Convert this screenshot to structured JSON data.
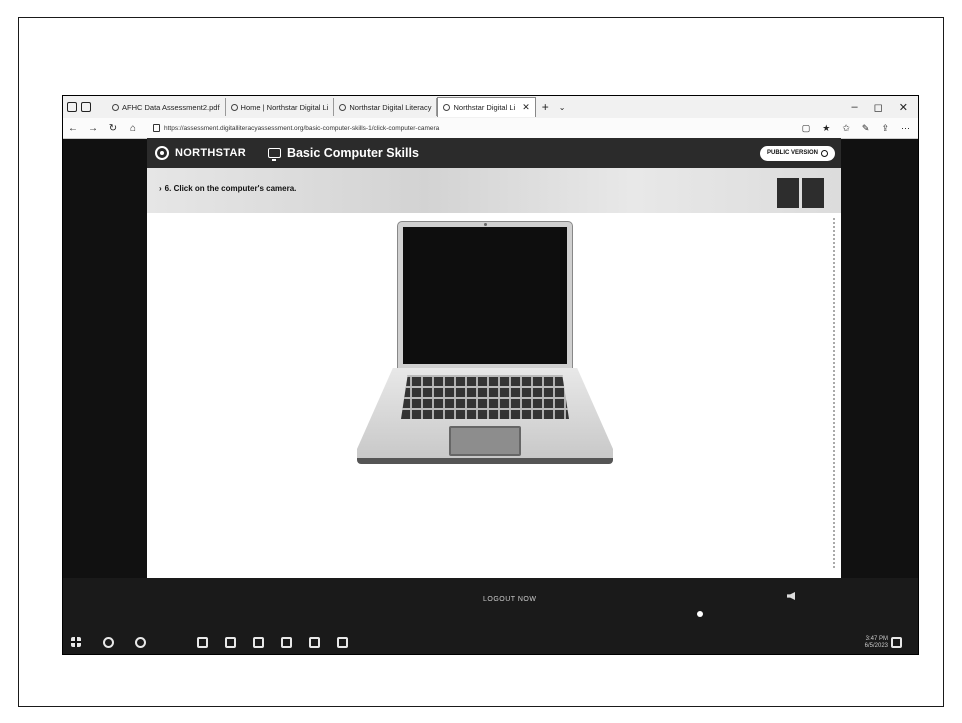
{
  "browser": {
    "tabs": [
      {
        "label": "AFHC Data Assessment2.pdf"
      },
      {
        "label": "Home | Northstar Digital Li"
      },
      {
        "label": "Northstar Digital Literacy"
      },
      {
        "label": "Northstar Digital Li",
        "active": true
      }
    ],
    "url": "https://assessment.digitalliteracyassessment.org/basic-computer-skills-1/click-computer-camera",
    "window_controls": [
      "–",
      "◻",
      "✕"
    ]
  },
  "northstar": {
    "brand": "NORTHSTAR",
    "module": "Basic Computer Skills",
    "badge": "PUBLIC VERSION"
  },
  "question": {
    "text": "6. Click on the computer's camera."
  },
  "footer": {
    "label": "LOGOUT NOW"
  },
  "taskbar": {
    "time": "3:47 PM",
    "date": "6/5/2023"
  }
}
